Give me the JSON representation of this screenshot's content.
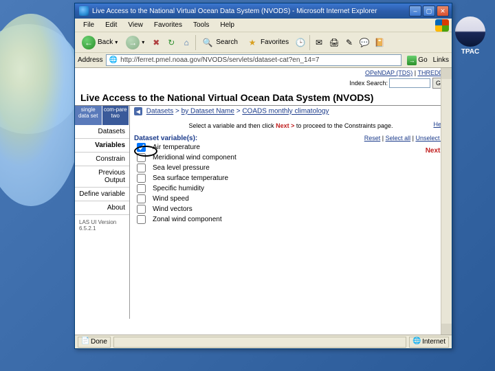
{
  "tpac": "TPAC",
  "window_title": "Live Access to the National Virtual Ocean Data System (NVODS) - Microsoft Internet Explorer",
  "menu": {
    "file": "File",
    "edit": "Edit",
    "view": "View",
    "fav": "Favorites",
    "tools": "Tools",
    "help": "Help"
  },
  "toolbar": {
    "back": "Back",
    "search": "Search",
    "favorites": "Favorites"
  },
  "address": {
    "label": "Address",
    "url": "http://ferret.pmel.noaa.gov/NVODS/servlets/dataset-cat?en_14=7",
    "go": "Go",
    "links": "Links"
  },
  "toplinks": {
    "opendap": "OPeNDAP (TDS)",
    "thredds": "THREDDS"
  },
  "search": {
    "label": "Index Search:",
    "go": "Go"
  },
  "page_title": "Live Access to the National Virtual Ocean Data System (NVODS)",
  "leftnav": {
    "tab1": "single data set",
    "tab2": "com-pare two",
    "items": {
      "datasets": "Datasets",
      "variables": "Variables",
      "constraints": "Constrain",
      "previous": "Previous Output",
      "define": "Define variable",
      "about": "About"
    },
    "ver_label": "LAS UI Version",
    "ver": "6.5.2.1"
  },
  "breadcrumb": {
    "a": "Datasets",
    "b": "by Dataset Name",
    "c": "COADS monthly climatology"
  },
  "instruct": {
    "pre": "Select a variable and then click ",
    "next": "Next >",
    "post": " to proceed to the Constraints page."
  },
  "help": "Help",
  "vars_title": "Dataset variable(s):",
  "var_controls": {
    "reset": "Reset",
    "selall": "Select all",
    "unselall": "Unselect all"
  },
  "next_label": "Next >",
  "variables": [
    {
      "name": "Air temperature",
      "checked": true
    },
    {
      "name": "Meridional wind component",
      "checked": false
    },
    {
      "name": "Sea level pressure",
      "checked": false
    },
    {
      "name": "Sea surface temperature",
      "checked": false
    },
    {
      "name": "Specific humidity",
      "checked": false
    },
    {
      "name": "Wind speed",
      "checked": false
    },
    {
      "name": "Wind vectors",
      "checked": false
    },
    {
      "name": "Zonal wind component",
      "checked": false
    }
  ],
  "status": {
    "done": "Done",
    "zone": "Internet"
  }
}
